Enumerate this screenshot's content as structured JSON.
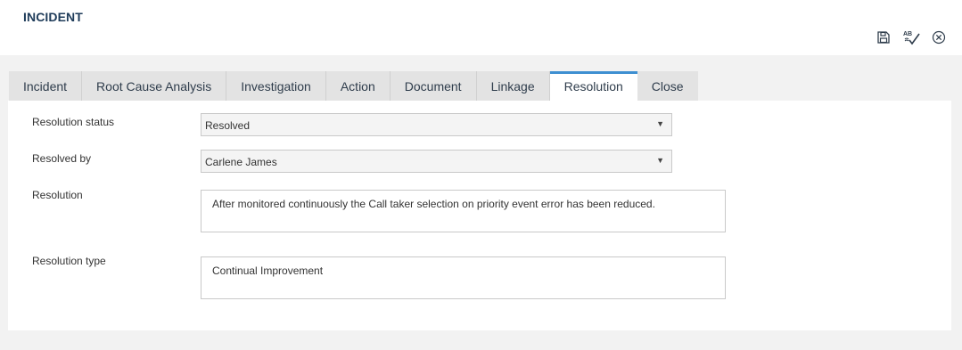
{
  "header": {
    "title": "INCIDENT",
    "toolbar": {
      "save_icon": "save-icon",
      "spellcheck_icon": "spellcheck-icon",
      "close_icon": "close-circle-icon"
    }
  },
  "tabs": [
    {
      "label": "Incident",
      "active": false
    },
    {
      "label": "Root Cause Analysis",
      "active": false
    },
    {
      "label": "Investigation",
      "active": false
    },
    {
      "label": "Action",
      "active": false
    },
    {
      "label": "Document",
      "active": false
    },
    {
      "label": "Linkage",
      "active": false
    },
    {
      "label": "Resolution",
      "active": true
    },
    {
      "label": "Close",
      "active": false
    }
  ],
  "form": {
    "resolution_status": {
      "label": "Resolution status",
      "value": "Resolved"
    },
    "resolved_by": {
      "label": "Resolved by",
      "value": "Carlene James"
    },
    "resolution": {
      "label": "Resolution",
      "value": "After monitored continuously the Call taker selection on priority event error has been reduced."
    },
    "resolution_type": {
      "label": "Resolution type",
      "value": "Continual Improvement"
    }
  },
  "colors": {
    "accent": "#3d8fd1",
    "title": "#1f3c5a",
    "tab_bg": "#e3e3e3",
    "page_bg": "#f2f2f2"
  }
}
